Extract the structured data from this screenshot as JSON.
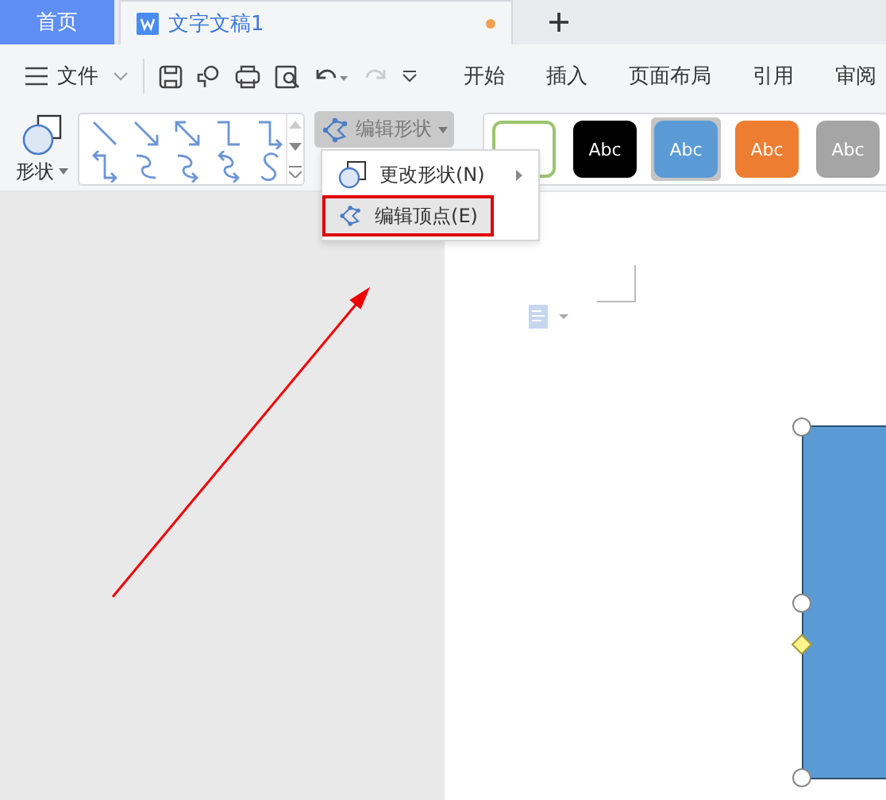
{
  "tabs": [
    {
      "label": "首页",
      "kind": "home",
      "selected": false
    },
    {
      "label": "文字文稿1",
      "kind": "document",
      "selected": true,
      "modified": true
    }
  ],
  "menu": {
    "label": "文件"
  },
  "ribbon_tabs": [
    "开始",
    "插入",
    "页面布局",
    "引用",
    "审阅"
  ],
  "shape_button": {
    "label": "形状"
  },
  "edit_shape_button": {
    "label": "编辑形状",
    "pressed": true
  },
  "dropdown": [
    {
      "label": "更改形状(N)",
      "has_submenu": true,
      "selected": false,
      "outlined": false
    },
    {
      "label": "编辑顶点(E)",
      "has_submenu": false,
      "selected": true,
      "outlined": true
    }
  ],
  "style_gallery": [
    {
      "kind": "outline",
      "color": "#9bc46f",
      "selected": false
    },
    {
      "label": "Abc",
      "kind": "filled",
      "color": "#000000",
      "selected": false
    },
    {
      "label": "Abc",
      "kind": "filled",
      "color": "#5b9bd5",
      "selected": true
    },
    {
      "label": "Abc",
      "kind": "filled",
      "color": "#ed7d31",
      "selected": false
    },
    {
      "label": "Abc",
      "kind": "filled",
      "color": "#a5a5a5",
      "selected": false
    }
  ]
}
